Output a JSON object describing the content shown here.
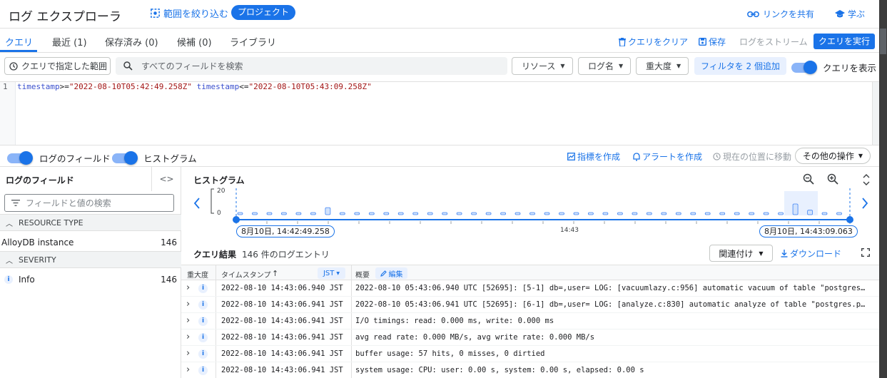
{
  "header": {
    "title": "ログ エクスプローラ",
    "narrow_scope": "範囲を絞り込む",
    "project_chip": "プロジェクト",
    "share_link": "リンクを共有",
    "learn": "学ぶ"
  },
  "tabs": [
    {
      "label": "クエリ",
      "active": true
    },
    {
      "label": "最近 (1)"
    },
    {
      "label": "保存済み (0)"
    },
    {
      "label": "候補 (0)"
    },
    {
      "label": "ライブラリ"
    }
  ],
  "toolbar": {
    "clear_query": "クエリをクリア",
    "save": "保存",
    "stream_logs": "ログをストリーム",
    "run_query": "クエリを実行"
  },
  "filter_bar": {
    "query_range": "クエリで指定した範囲",
    "search_placeholder": "すべてのフィールドを検索",
    "resource": "リソース",
    "log_name": "ログ名",
    "severity": "重大度",
    "add_filters": "フィルタを 2 個追加",
    "show_query": "クエリを表示"
  },
  "editor": {
    "line_number": "1",
    "tokens": [
      "timestamp",
      ">=",
      "\"2022-08-10T05:42:49.258Z\"",
      "timestamp",
      "<=",
      "\"2022-08-10T05:43:09.258Z\""
    ]
  },
  "panel_toggles": {
    "log_fields": "ログのフィールド",
    "histogram": "ヒストグラム",
    "create_metric": "指標を作成",
    "create_alert": "アラートを作成",
    "jump_now": "現在の位置に移動",
    "more_actions": "その他の操作"
  },
  "fields_panel": {
    "title": "ログのフィールド",
    "search_placeholder": "フィールドと値の検索",
    "sections": [
      {
        "title": "RESOURCE TYPE",
        "items": [
          {
            "label": "AlloyDB instance",
            "count": "146"
          }
        ]
      },
      {
        "title": "SEVERITY",
        "items": [
          {
            "label": "Info",
            "count": "146"
          }
        ]
      }
    ]
  },
  "histogram": {
    "title": "ヒストグラム",
    "y_max": "20",
    "y_min": "0",
    "start_label": "8月10日, 14:42:49.258",
    "end_label": "8月10日, 14:43:09.063",
    "mid_tick": "14:43"
  },
  "chart_data": {
    "type": "bar",
    "ylim": [
      0,
      20
    ],
    "values": [
      0.3,
      0.3,
      0.3,
      0.3,
      0.3,
      0.3,
      2.5,
      0.3,
      0.3,
      0.6,
      0.3,
      0.3,
      0.3,
      0.3,
      0.3,
      0.3,
      0.3,
      0.3,
      0.3,
      0.3,
      0.3,
      0.3,
      0.3,
      0.3,
      0.3,
      0.3,
      0.3,
      0.3,
      0.3,
      0.3,
      0.3,
      0.3,
      0.3,
      0.3,
      0.3,
      0.3,
      0.3,
      0.3,
      3.8,
      1.6,
      0.3,
      0.3
    ]
  },
  "results": {
    "title": "クエリ結果",
    "count": "146 件のログエントリ",
    "sort": "関連付け",
    "download": "ダウンロード",
    "columns": {
      "severity": "重大度",
      "timestamp": "タイムスタンプ",
      "timezone": "JST",
      "summary": "概要",
      "edit": "編集"
    },
    "rows": [
      {
        "ts": "2022-08-10 14:43:06.940 JST",
        "summary": "2022-08-10 05:43:06.940 UTC [52695]: [5-1] db=,user= LOG: [vacuumlazy.c:956] automatic vacuum of table \"postgres.public.pgbench_branches\""
      },
      {
        "ts": "2022-08-10 14:43:06.941 JST",
        "summary": "2022-08-10 05:43:06.941 UTC [52695]: [6-1] db=,user= LOG: [analyze.c:830] automatic analyze of table \"postgres.public.pgbench_branches\""
      },
      {
        "ts": "2022-08-10 14:43:06.941 JST",
        "summary": " I/O timings: read: 0.000 ms, write: 0.000 ms"
      },
      {
        "ts": "2022-08-10 14:43:06.941 JST",
        "summary": " avg read rate: 0.000 MB/s, avg write rate: 0.000 MB/s"
      },
      {
        "ts": "2022-08-10 14:43:06.941 JST",
        "summary": " buffer usage: 57 hits, 0 misses, 0 dirtied"
      },
      {
        "ts": "2022-08-10 14:43:06.941 JST",
        "summary": " system usage: CPU: user: 0.00 s, system: 0.00 s, elapsed: 0.00 s"
      }
    ]
  }
}
